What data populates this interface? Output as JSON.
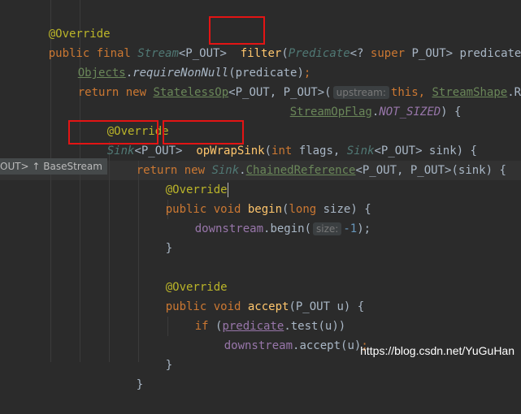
{
  "tooltip": "OUT> ↑ BaseStream",
  "watermark": "https://blog.csdn.net/YuGuHan",
  "hints": {
    "upstream": "upstream:",
    "size": "size:"
  },
  "code": {
    "l1_ann": "@Override",
    "l2_public": "public final ",
    "l2_stream": "Stream",
    "l2_generic": "<P_OUT> ",
    "l2_filter": "filter",
    "l2_paren": "(",
    "l2_predtype": "Predicate",
    "l2_rest1": "<? ",
    "l2_super": "super ",
    "l2_rest2": "P_OUT> predicate)",
    "l3_objects": "Objects",
    "l3_dot": ".",
    "l3_req": "requireNonNull",
    "l3_args": "(predicate)",
    "l3_semi": ";",
    "l4_return": "return new ",
    "l4_stateless": "StatelessOp",
    "l4_gen": "<P_OUT, P_OUT>(",
    "l4_this": "this, ",
    "l4_shape": "StreamShape",
    "l4_dotR": ".R",
    "l5_flag": "StreamOpFlag",
    "l5_dot": ".",
    "l5_notsized": "NOT_SIZED",
    "l5_end": ") {",
    "l6_ann": "@Override",
    "l7_sink": "Sink",
    "l7_gen": "<P_OUT> ",
    "l7_opwrap": "opWrapSink",
    "l7_paren": "(",
    "l7_int": "int ",
    "l7_flags": "flags, ",
    "l7_sink2": "Sink",
    "l7_rest": "<P_OUT> sink) {",
    "l8_return": "return new ",
    "l8_sink": "Sink",
    "l8_dot": ".",
    "l8_chained": "ChainedReference",
    "l8_rest": "<P_OUT, P_OUT>(sink) {",
    "l9_ann": "@Override",
    "l10_pv": "public void ",
    "l10_begin": "begin",
    "l10_paren": "(",
    "l10_long": "long ",
    "l10_rest": "size) {",
    "l11_ds": "downstream",
    "l11_call": ".begin(",
    "l11_num": "-1",
    "l11_end": ");",
    "l12_brace": "}",
    "l14_ann": "@Override",
    "l15_pv": "public void ",
    "l15_accept": "accept",
    "l15_rest": "(P_OUT u) {",
    "l16_if": "if ",
    "l16_p1": "(",
    "l16_pred": "predicate",
    "l16_rest": ".test(u))",
    "l17_ds": "downstream",
    "l17_call": ".accept(u)",
    "l17_semi": ";",
    "l18_brace": "}",
    "l19_end": "}"
  }
}
